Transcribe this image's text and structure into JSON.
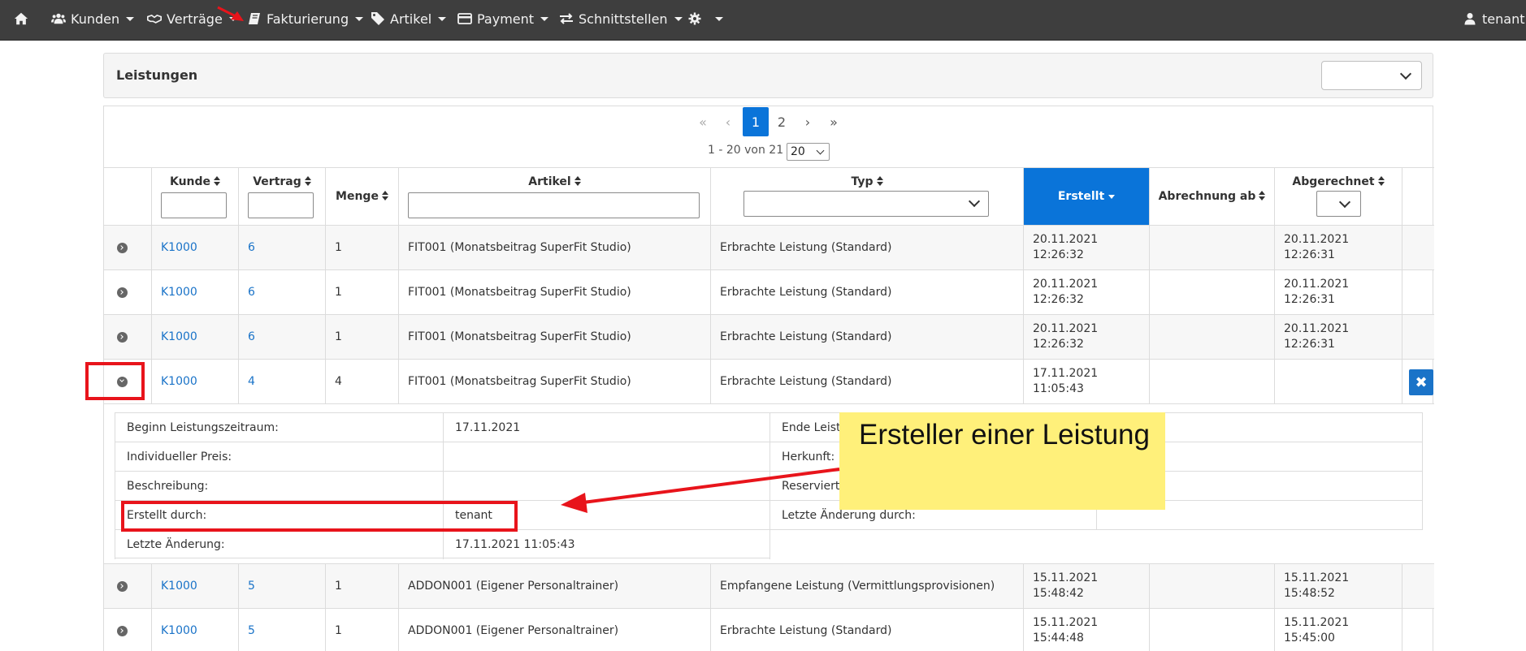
{
  "nav": {
    "items": [
      {
        "label": "Kunden",
        "icon": "users-icon"
      },
      {
        "label": "Verträge",
        "icon": "handshake-icon"
      },
      {
        "label": "Fakturierung",
        "icon": "book-icon"
      },
      {
        "label": "Artikel",
        "icon": "tags-icon"
      },
      {
        "label": "Payment",
        "icon": "credit-card-icon"
      },
      {
        "label": "Schnittstellen",
        "icon": "exchange-icon"
      },
      {
        "label": "",
        "icon": "gear-icon"
      }
    ],
    "user": "tenant"
  },
  "panel": {
    "title": "Leistungen"
  },
  "pager": {
    "pages": [
      "1",
      "2"
    ],
    "active_page": "1",
    "first": "«",
    "prev": "‹",
    "next": "›",
    "last": "»",
    "info": "1 - 20 von 21",
    "page_size": "20"
  },
  "table": {
    "headers": {
      "kunde": "Kunde",
      "vertrag": "Vertrag",
      "menge": "Menge",
      "artikel": "Artikel",
      "typ": "Typ",
      "erstellt": "Erstellt",
      "abrechnung_ab": "Abrechnung ab",
      "abgerechnet": "Abgerechnet"
    },
    "rows": [
      {
        "kunde": "K1000",
        "vertrag": "6",
        "menge": "1",
        "artikel": "FIT001 (Monatsbeitrag SuperFit Studio)",
        "typ": "Erbrachte Leistung (Standard)",
        "erstellt_date": "20.11.2021",
        "erstellt_time": "12:26:32",
        "abgerechnet_date": "20.11.2021",
        "abgerechnet_time": "12:26:31"
      },
      {
        "kunde": "K1000",
        "vertrag": "6",
        "menge": "1",
        "artikel": "FIT001 (Monatsbeitrag SuperFit Studio)",
        "typ": "Erbrachte Leistung (Standard)",
        "erstellt_date": "20.11.2021",
        "erstellt_time": "12:26:32",
        "abgerechnet_date": "20.11.2021",
        "abgerechnet_time": "12:26:31"
      },
      {
        "kunde": "K1000",
        "vertrag": "6",
        "menge": "1",
        "artikel": "FIT001 (Monatsbeitrag SuperFit Studio)",
        "typ": "Erbrachte Leistung (Standard)",
        "erstellt_date": "20.11.2021",
        "erstellt_time": "12:26:32",
        "abgerechnet_date": "20.11.2021",
        "abgerechnet_time": "12:26:31"
      },
      {
        "kunde": "K1000",
        "vertrag": "4",
        "menge": "4",
        "artikel": "FIT001 (Monatsbeitrag SuperFit Studio)",
        "typ": "Erbrachte Leistung (Standard)",
        "erstellt_date": "17.11.2021",
        "erstellt_time": "11:05:43",
        "abgerechnet_date": "",
        "abgerechnet_time": ""
      },
      {
        "kunde": "K1000",
        "vertrag": "5",
        "menge": "1",
        "artikel": "ADDON001 (Eigener Personaltrainer)",
        "typ": "Empfangene Leistung (Vermittlungsprovisionen)",
        "erstellt_date": "15.11.2021",
        "erstellt_time": "15:48:42",
        "abgerechnet_date": "15.11.2021",
        "abgerechnet_time": "15:48:52"
      },
      {
        "kunde": "K1000",
        "vertrag": "5",
        "menge": "1",
        "artikel": "ADDON001 (Eigener Personaltrainer)",
        "typ": "Erbrachte Leistung (Standard)",
        "erstellt_date": "15.11.2021",
        "erstellt_time": "15:44:48",
        "abgerechnet_date": "15.11.2021",
        "abgerechnet_time": "15:45:00"
      }
    ],
    "delete_symbol": "✖"
  },
  "detail": {
    "beginn_label": "Beginn Leistungszeitraum:",
    "beginn_value": "17.11.2021",
    "ende_label": "Ende Leistu",
    "preis_label": "Individueller Preis:",
    "herkunft_label": "Herkunft:",
    "beschreibung_label": "Beschreibung:",
    "reserviert_label": "Reservierte",
    "erstellt_durch_label": "Erstellt durch:",
    "erstellt_durch_value": "tenant",
    "letzte_aenderung_durch_label": "Letzte Änderung durch:",
    "letzte_aenderung_label": "Letzte Änderung:",
    "letzte_aenderung_value": "17.11.2021 11:05:43"
  },
  "annotation": {
    "sticky_text": "Ersteller einer Leistung",
    "colors": {
      "red": "#e8141b",
      "sticky": "#fff07a"
    }
  }
}
